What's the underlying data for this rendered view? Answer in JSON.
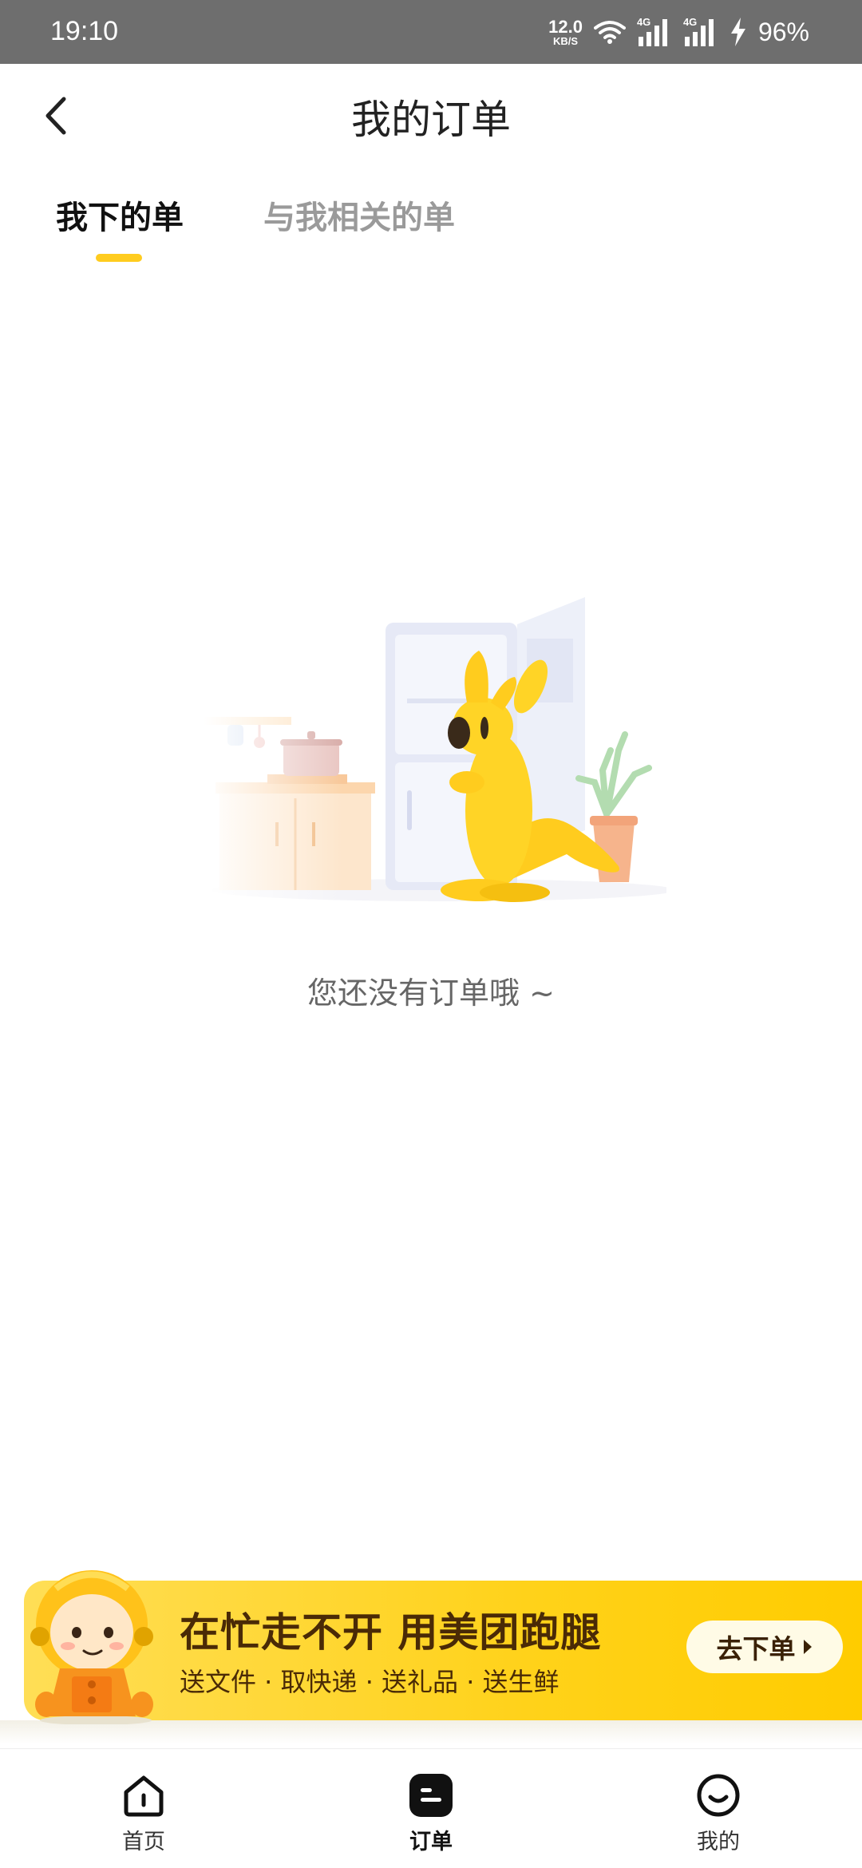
{
  "status_bar": {
    "time": "19:10",
    "net_speed_value": "12.0",
    "net_speed_unit": "KB/S",
    "network_1": "4G",
    "network_2": "4G",
    "battery": "96%"
  },
  "header": {
    "title": "我的订单",
    "back_icon": "chevron-left-icon"
  },
  "tabs": [
    {
      "label": "我下的单",
      "active": true
    },
    {
      "label": "与我相关的单",
      "active": false
    }
  ],
  "empty_state": {
    "illustration": "kangaroo-kitchen-illustration",
    "message": "您还没有订单哦 ~"
  },
  "promo": {
    "title": "在忙走不开 用美团跑腿",
    "subtitle": "送文件 · 取快递 · 送礼品 · 送生鲜",
    "button_label": "去下单"
  },
  "bottom_nav": [
    {
      "label": "首页",
      "icon": "home-icon",
      "active": false
    },
    {
      "label": "订单",
      "icon": "order-icon",
      "active": true
    },
    {
      "label": "我的",
      "icon": "profile-icon",
      "active": false
    }
  ],
  "colors": {
    "accent": "#ffcc1f",
    "promo_bg": "#ffd21a",
    "promo_text": "#4a2a06",
    "status_bar": "#6e6e6e"
  }
}
